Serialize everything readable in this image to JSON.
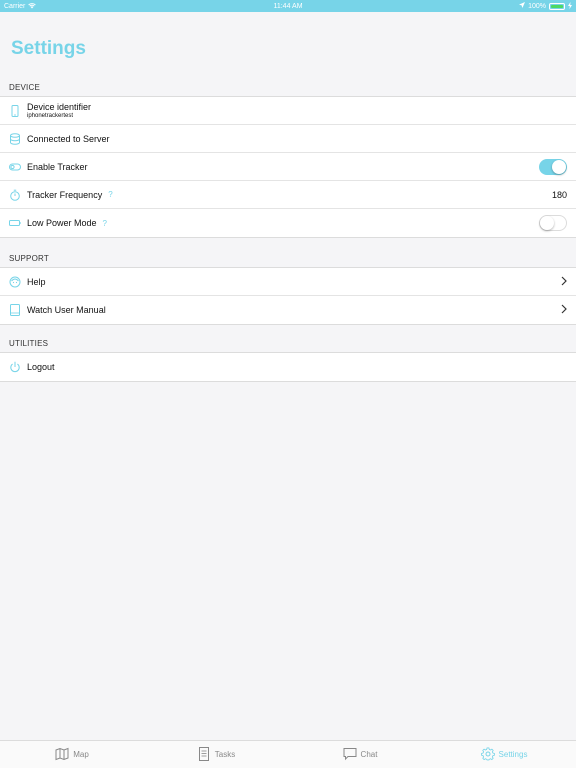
{
  "status_bar": {
    "carrier": "Carrier",
    "time": "11:44 AM",
    "battery": "100%",
    "battery_level": 1.0
  },
  "page": {
    "title": "Settings"
  },
  "sections": {
    "device": {
      "header": "DEVICE",
      "device_identifier_label": "Device identifier",
      "device_identifier_value": "iphonetrackertest",
      "connected_label": "Connected to Server",
      "enable_tracker_label": "Enable Tracker",
      "enable_tracker_on": true,
      "tracker_frequency_label": "Tracker Frequency",
      "tracker_frequency_help": "?",
      "tracker_frequency_value": "180",
      "low_power_label": "Low Power Mode",
      "low_power_help": "?",
      "low_power_on": false
    },
    "support": {
      "header": "SUPPORT",
      "help_label": "Help",
      "manual_label": "Watch User Manual"
    },
    "utilities": {
      "header": "UTILITIES",
      "logout_label": "Logout"
    }
  },
  "tabbar": {
    "map": "Map",
    "tasks": "Tasks",
    "chat": "Chat",
    "settings": "Settings",
    "active": "settings"
  },
  "colors": {
    "accent": "#77d4e8",
    "battery": "#4cd964"
  }
}
